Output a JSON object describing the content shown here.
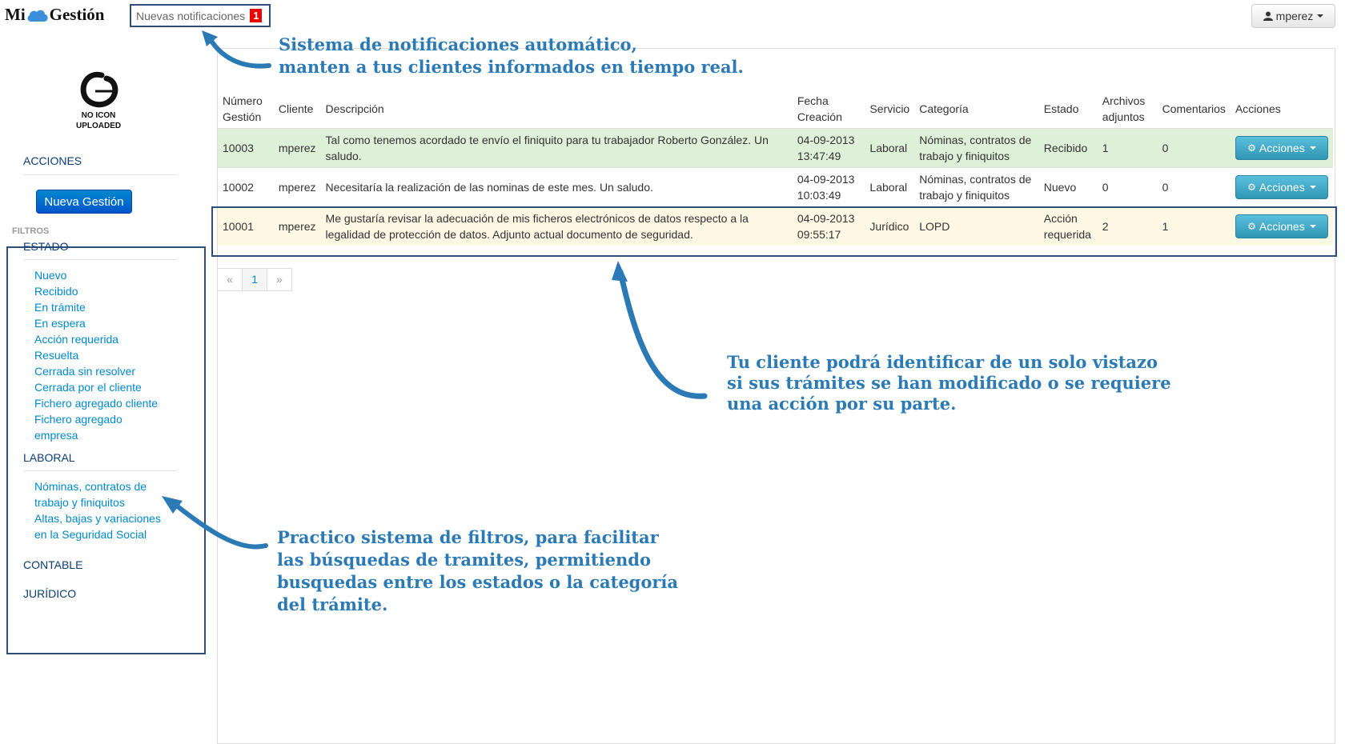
{
  "header": {
    "logo_left": "Mi",
    "logo_right": "Gestión",
    "notifications_label": "Nuevas notificaciones",
    "notifications_count": "1",
    "user_label": "mperez"
  },
  "sidebar": {
    "logo_line1": "NO ICON",
    "logo_line2": "UPLOADED",
    "acciones_heading": "ACCIONES",
    "new_button": "Nueva Gestión",
    "filtros_label": "FILTROS",
    "estado_heading": "ESTADO",
    "estado_items": [
      "Nuevo",
      "Recibido",
      "En trámite",
      "En espera",
      "Acción requerida",
      "Resuelta",
      "Cerrada sin resolver",
      "Cerrada por el cliente",
      "Fichero agregado cliente",
      "Fichero agregado",
      "empresa"
    ],
    "laboral_heading": "LABORAL",
    "laboral_items": [
      "Nóminas, contratos de",
      "trabajo y finiquitos",
      "Altas, bajas y variaciones",
      "en la Seguridad Social"
    ],
    "contable_heading": "CONTABLE",
    "juridico_heading": "JURÍDICO"
  },
  "table": {
    "headers": {
      "numero_1": "Número",
      "numero_2": "Gestión",
      "cliente": "Cliente",
      "descripcion": "Descripción",
      "fecha_1": "Fecha",
      "fecha_2": "Creación",
      "servicio": "Servicio",
      "categoria": "Categoría",
      "estado": "Estado",
      "archivos_1": "Archivos",
      "archivos_2": "adjuntos",
      "comentarios": "Comentarios",
      "acciones": "Acciones"
    },
    "rows": [
      {
        "numero": "10003",
        "cliente": "mperez",
        "descripcion": "Tal como tenemos acordado te envío el finiquito para tu trabajador Roberto González. Un saludo.",
        "fecha": "04-09-2013",
        "hora": "13:47:49",
        "servicio": "Laboral",
        "categoria": "Nóminas, contratos de trabajo y finiquitos",
        "estado": "Recibido",
        "archivos": "1",
        "comentarios": "0",
        "accion": "Acciones"
      },
      {
        "numero": "10002",
        "cliente": "mperez",
        "descripcion": "Necesitaría la realización de las nominas de este mes. Un saludo.",
        "fecha": "04-09-2013",
        "hora": "10:03:49",
        "servicio": "Laboral",
        "categoria": "Nóminas, contratos de trabajo y finiquitos",
        "estado": "Nuevo",
        "archivos": "0",
        "comentarios": "0",
        "accion": "Acciones"
      },
      {
        "numero": "10001",
        "cliente": "mperez",
        "descripcion": "Me gustaría revisar la adecuación de mis ficheros electrónicos de datos respecto a la legalidad de protección de datos. Adjunto actual documento de seguridad.",
        "fecha": "04-09-2013",
        "hora": "09:55:17",
        "servicio": "Jurídico",
        "categoria": "LOPD",
        "estado": "Acción requerida",
        "archivos": "2",
        "comentarios": "1",
        "accion": "Acciones"
      }
    ]
  },
  "pager": {
    "prev": "«",
    "current": "1",
    "next": "»"
  },
  "annotations": {
    "notif_1": "Sistema de notificaciones automático,",
    "notif_2": "manten a tus clientes informados en tiempo real.",
    "estado_1": "Tu cliente podrá identificar de un solo vistazo",
    "estado_2": "si sus trámites se han modificado o se requiere",
    "estado_3": "una acción por su parte.",
    "filtros_1": "Practico sistema de filtros, para facilitar",
    "filtros_2": "las búsquedas de tramites, permitiendo",
    "filtros_3": "busquedas entre los estados o la categoría",
    "filtros_4": "del trámite."
  },
  "colors": {
    "annotation": "#2b7ab6",
    "frame": "#2d4f79",
    "link": "#0088cc",
    "row_green": "#dff0d8",
    "row_yellow": "#fcf8e3"
  }
}
